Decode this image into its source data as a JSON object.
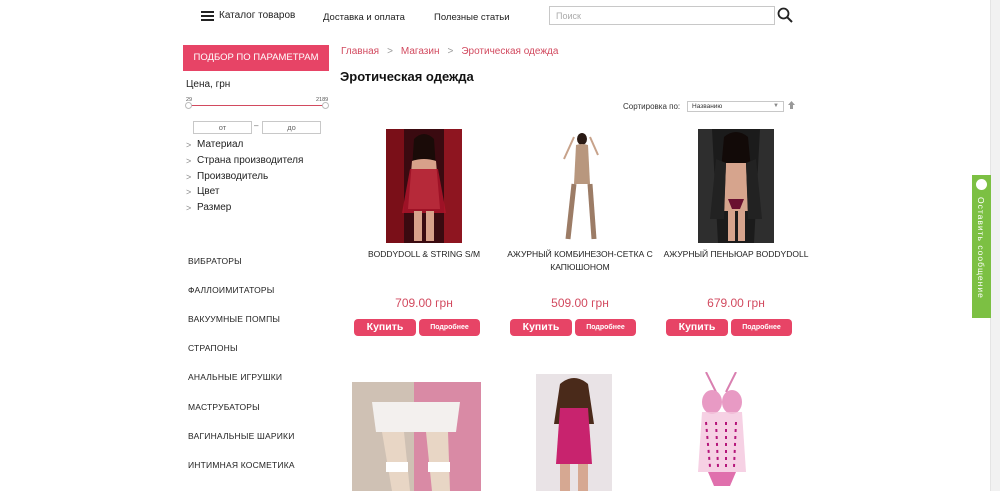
{
  "header": {
    "catalog_label": "Каталог товаров",
    "nav": [
      {
        "label": "Доставка и оплата"
      },
      {
        "label": "Полезные статьи"
      }
    ],
    "search_placeholder": "Поиск"
  },
  "sidebar": {
    "filter_button": "ПОДБОР ПО ПАРАМЕТРАМ",
    "price_label": "Цена, грн",
    "range_min": "29",
    "range_max": "2189",
    "from_placeholder": "от",
    "to_placeholder": "до",
    "dash": "–",
    "filters": [
      {
        "label": "Материал"
      },
      {
        "label": "Страна производителя"
      },
      {
        "label": "Производитель"
      },
      {
        "label": "Цвет"
      },
      {
        "label": "Размер"
      }
    ],
    "categories": [
      {
        "label": "ВИБРАТОРЫ"
      },
      {
        "label": "ФАЛЛОИМИТАТОРЫ"
      },
      {
        "label": "ВАКУУМНЫЕ ПОМПЫ"
      },
      {
        "label": "СТРАПОНЫ"
      },
      {
        "label": "АНАЛЬНЫЕ ИГРУШКИ"
      },
      {
        "label": "МАСТРУБАТОРЫ"
      },
      {
        "label": "ВАГИНАЛЬНЫЕ ШАРИКИ"
      },
      {
        "label": "ИНТИМНАЯ КОСМЕТИКА"
      }
    ]
  },
  "breadcrumb": {
    "items": [
      "Главная",
      "Магазин",
      "Эротическая одежда"
    ],
    "separator": ">"
  },
  "page_title": "Эротическая одежда",
  "sort": {
    "label": "Сортировка по:",
    "value": "Названию"
  },
  "products": [
    {
      "name": "BODDYDOLL & STRING S/M",
      "price": "709.00 грн",
      "buy_label": "Купить",
      "more_label": "Подробнее"
    },
    {
      "name": "АЖУРНЫЙ КОМБИНЕЗОН-СЕТКА С КАПЮШОНОМ",
      "price": "509.00 грн",
      "buy_label": "Купить",
      "more_label": "Подробнее"
    },
    {
      "name": "АЖУРНЫЙ ПЕНЬЮАР BODDYDOLL",
      "price": "679.00 грн",
      "buy_label": "Купить",
      "more_label": "Подробнее"
    },
    {
      "name": "",
      "price": "",
      "buy_label": "",
      "more_label": ""
    },
    {
      "name": "",
      "price": "",
      "buy_label": "",
      "more_label": ""
    },
    {
      "name": "",
      "price": "",
      "buy_label": "",
      "more_label": ""
    }
  ],
  "feedback_widget": {
    "label": "Оставить сообщение",
    "color": "#7cc043"
  },
  "colors": {
    "accent": "#e74466",
    "link": "#d24a5f"
  }
}
